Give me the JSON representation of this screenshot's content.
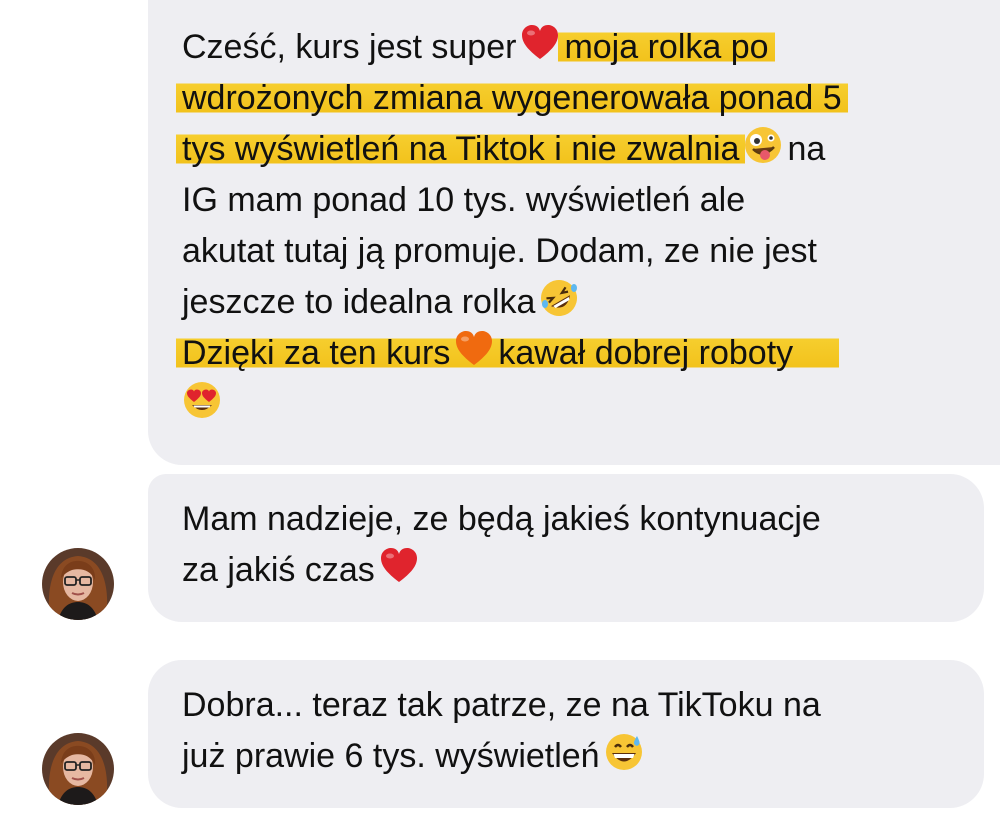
{
  "messages": [
    {
      "lines": [
        {
          "a": "Cześć, kurs jest super",
          "b": "moja rolka po"
        },
        {
          "a": "wdrożonych zmiana wygenerowała ponad 5"
        },
        {
          "a": "tys wyświetleń na Tiktok i nie zwalnia",
          "b": "na"
        },
        {
          "a": "IG mam ponad 10 tys. wyświetleń ale"
        },
        {
          "a": "akutat tutaj ją promuje. Dodam, ze nie jest"
        },
        {
          "a": "jeszcze to idealna rolka"
        },
        {
          "a": "Dzięki za ten kurs",
          "b": "kawał dobrej roboty"
        }
      ],
      "emojis": [
        "red-heart",
        "zany-face",
        "rolling-laughing-face",
        "orange-heart",
        "heart-eyes-face"
      ]
    },
    {
      "lines": [
        {
          "a": "Mam nadzieje, ze będą jakieś kontynuacje"
        },
        {
          "a": "za jakiś czas"
        }
      ],
      "emojis": [
        "red-heart"
      ]
    },
    {
      "lines": [
        {
          "a": "Dobra... teraz tak patrze, ze na TikToku na"
        },
        {
          "a": "już prawie 6 tys. wyświetleń"
        }
      ],
      "emojis": [
        "grinning-sweat-face"
      ]
    }
  ],
  "colors": {
    "bubble": "#EEEEF2",
    "highlight": "#F2C21C",
    "text": "#111111",
    "heart_red": "#E0242D",
    "heart_orange": "#F06A0F"
  }
}
